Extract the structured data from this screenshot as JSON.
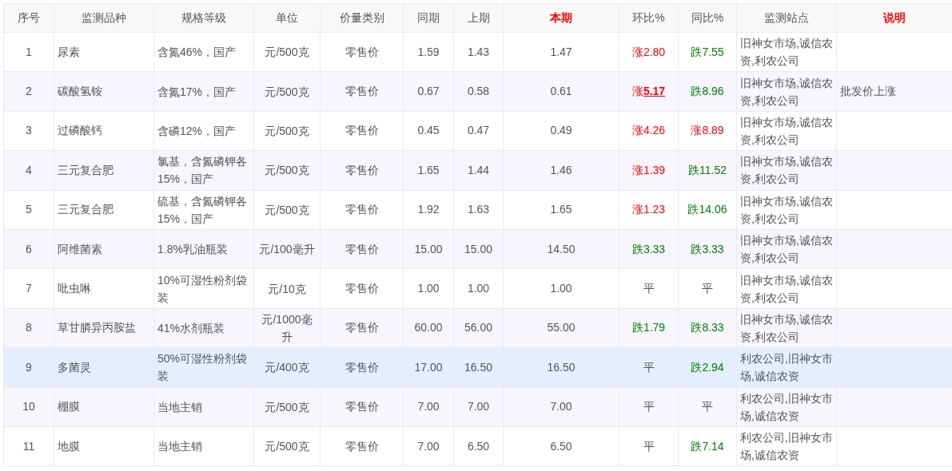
{
  "table": {
    "columns": [
      {
        "label": "序号",
        "emphasis": false
      },
      {
        "label": "监测品种",
        "emphasis": false
      },
      {
        "label": "规格等级",
        "emphasis": false
      },
      {
        "label": "单位",
        "emphasis": false
      },
      {
        "label": "价量类别",
        "emphasis": false
      },
      {
        "label": "同期",
        "emphasis": false
      },
      {
        "label": "上期",
        "emphasis": false
      },
      {
        "label": "本期",
        "emphasis": true
      },
      {
        "label": "环比%",
        "emphasis": false
      },
      {
        "label": "同比%",
        "emphasis": false
      },
      {
        "label": "监测站点",
        "emphasis": false
      },
      {
        "label": "说明",
        "emphasis": true
      }
    ],
    "rows": [
      {
        "no": "1",
        "name": "尿素",
        "spec": "含氮46%，国产",
        "unit": "元/500克",
        "price_type": "零售价",
        "same_period": "1.59",
        "last_period": "1.43",
        "current": "1.47",
        "mom": {
          "text": "涨2.80",
          "kind": "up"
        },
        "yoy": {
          "text": "跌7.55",
          "kind": "down"
        },
        "stations": "旧神女市场,诚信农资,利农公司",
        "highlighted": false
      },
      {
        "no": "2",
        "name": "碳酸氢铵",
        "spec": "含氮17%，国产",
        "unit": "元/500克",
        "price_type": "零售价",
        "same_period": "0.67",
        "last_period": "0.58",
        "current": "0.61",
        "mom": {
          "text": "涨**5.17**",
          "kind": "up"
        },
        "yoy": {
          "text": "跌8.96",
          "kind": "down"
        },
        "stations": "旧神女市场,诚信农资,利农公司",
        "note": "批发价上涨",
        "highlighted": false
      },
      {
        "no": "3",
        "name": "过磷酸钙",
        "spec": "含磷12%，国产",
        "unit": "元/500克",
        "price_type": "零售价",
        "same_period": "0.45",
        "last_period": "0.47",
        "current": "0.49",
        "mom": {
          "text": "涨4.26",
          "kind": "up"
        },
        "yoy": {
          "text": "涨8.89",
          "kind": "up"
        },
        "stations": "旧神女市场,诚信农资,利农公司",
        "highlighted": false
      },
      {
        "no": "4",
        "name": "三元复合肥",
        "spec": "氯基，含氮磷钾各15%，国产",
        "unit": "元/500克",
        "price_type": "零售价",
        "same_period": "1.65",
        "last_period": "1.44",
        "current": "1.46",
        "mom": {
          "text": "涨1.39",
          "kind": "up"
        },
        "yoy": {
          "text": "跌11.52",
          "kind": "down"
        },
        "stations": "旧神女市场,诚信农资,利农公司",
        "highlighted": false
      },
      {
        "no": "5",
        "name": "三元复合肥",
        "spec": "硫基，含氮磷钾各15%，国产",
        "unit": "元/500克",
        "price_type": "零售价",
        "same_period": "1.92",
        "last_period": "1.63",
        "current": "1.65",
        "mom": {
          "text": "涨1.23",
          "kind": "up"
        },
        "yoy": {
          "text": "跌14.06",
          "kind": "down"
        },
        "stations": "旧神女市场,诚信农资,利农公司",
        "highlighted": false
      },
      {
        "no": "6",
        "name": "阿维菌素",
        "spec": "1.8%乳油瓶装",
        "unit": "元/100毫升",
        "price_type": "零售价",
        "same_period": "15.00",
        "last_period": "15.00",
        "current": "14.50",
        "mom": {
          "text": "跌3.33",
          "kind": "down"
        },
        "yoy": {
          "text": "跌3.33",
          "kind": "down"
        },
        "stations": "旧神女市场,诚信农资,利农公司",
        "highlighted": false
      },
      {
        "no": "7",
        "name": "吡虫啉",
        "spec": "10%可湿性粉剂袋装",
        "unit": "元/10克",
        "price_type": "零售价",
        "same_period": "1.00",
        "last_period": "1.00",
        "current": "1.00",
        "mom": {
          "text": "平",
          "kind": "flat"
        },
        "yoy": {
          "text": "平",
          "kind": "flat"
        },
        "stations": "旧神女市场,诚信农资,利农公司",
        "highlighted": false
      },
      {
        "no": "8",
        "name": "草甘膦异丙胺盐",
        "spec": "41%水剂瓶装",
        "unit": "元/1000毫升",
        "price_type": "零售价",
        "same_period": "60.00",
        "last_period": "56.00",
        "current": "55.00",
        "mom": {
          "text": "跌1.79",
          "kind": "down"
        },
        "yoy": {
          "text": "跌8.33",
          "kind": "down"
        },
        "stations": "旧神女市场,诚信农资,利农公司",
        "highlighted": false
      },
      {
        "no": "9",
        "name": "多菌灵",
        "spec": "50%可湿性粉剂袋装",
        "unit": "元/400克",
        "price_type": "零售价",
        "same_period": "17.00",
        "last_period": "16.50",
        "current": "16.50",
        "mom": {
          "text": "平",
          "kind": "flat"
        },
        "yoy": {
          "text": "跌2.94",
          "kind": "down"
        },
        "stations": "利农公司,旧神女市场,诚信农资",
        "highlighted": true
      },
      {
        "no": "10",
        "name": "棚膜",
        "spec": "当地主销",
        "unit": "元/500克",
        "price_type": "零售价",
        "same_period": "7.00",
        "last_period": "7.00",
        "current": "7.00",
        "mom": {
          "text": "平",
          "kind": "flat"
        },
        "yoy": {
          "text": "平",
          "kind": "flat"
        },
        "stations": "利农公司,旧神女市场,诚信农资",
        "highlighted": false
      },
      {
        "no": "11",
        "name": "地膜",
        "spec": "当地主销",
        "unit": "元/500克",
        "price_type": "零售价",
        "same_period": "7.00",
        "last_period": "6.50",
        "current": "6.50",
        "mom": {
          "text": "平",
          "kind": "flat"
        },
        "yoy": {
          "text": "跌7.14",
          "kind": "down"
        },
        "stations": "利农公司,旧神女市场,诚信农资",
        "highlighted": false
      }
    ]
  }
}
